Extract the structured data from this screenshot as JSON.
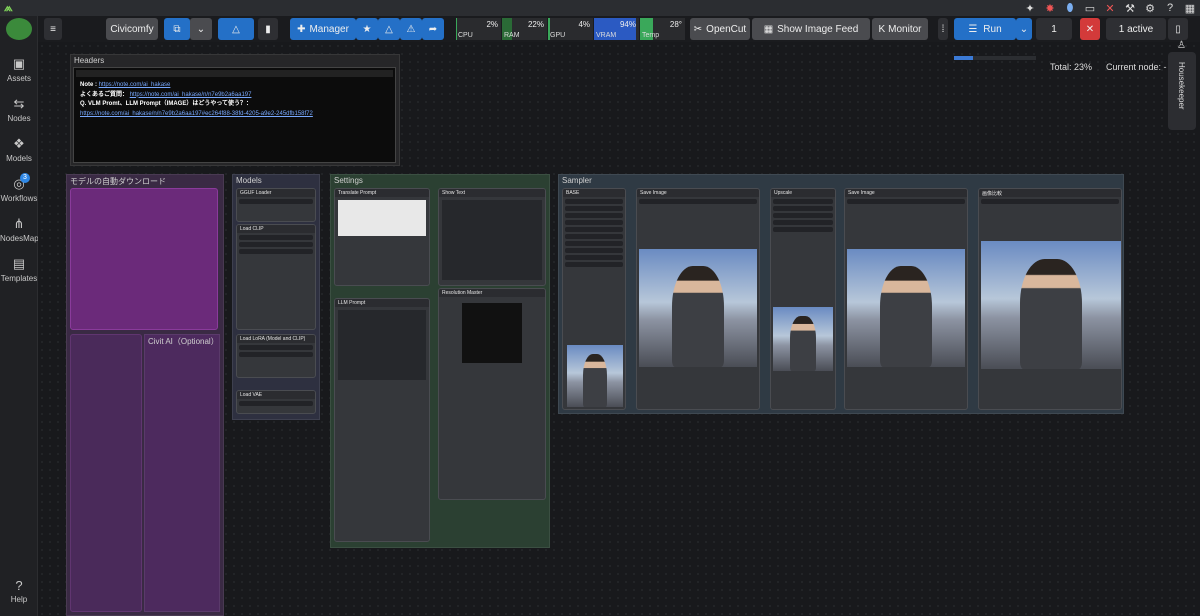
{
  "toolbar": {
    "app_name": "Civicomfy",
    "manager_label": "Manager",
    "opencut_label": "OpenCut",
    "show_feed_label": "Show Image Feed",
    "monitor_label": "Monitor",
    "run_label": "Run",
    "queue_count": "1",
    "active_label": "1 active"
  },
  "meters": [
    {
      "label": "CPU",
      "value": "2%",
      "color": "#3aa85a",
      "level": 0.02
    },
    {
      "label": "RAM",
      "value": "22%",
      "color": "#2a6a36",
      "level": 0.22
    },
    {
      "label": "GPU",
      "value": "4%",
      "color": "#3aa85a",
      "level": 0.04
    },
    {
      "label": "VRAM",
      "value": "94%",
      "color": "#2b5ac2",
      "level": 0.94
    },
    {
      "label": "Temp",
      "value": "28°",
      "color": "#3aa85a",
      "level": 0.28
    }
  ],
  "sidebar": {
    "items": [
      {
        "label": "Assets"
      },
      {
        "label": "Nodes"
      },
      {
        "label": "Models"
      },
      {
        "label": "Workflows",
        "badge": "3"
      },
      {
        "label": "NodesMap"
      },
      {
        "label": "Templates"
      },
      {
        "label": "Help"
      }
    ]
  },
  "status": {
    "total_label": "Total: 23%",
    "current_node_label": "Current node: -",
    "progress": 0.23
  },
  "housekeeper": "Housekeeper",
  "groups": {
    "headers": "Headers",
    "auto_download": "モデルの自動ダウンロード",
    "models": "Models",
    "settings": "Settings",
    "sampler": "Sampler",
    "civit_ai": "Civit AI（Optional）"
  },
  "notes": {
    "note_label": "Note :",
    "note_url": "https://note.com/ai_hakase",
    "faq_label": "よくあるご質問：",
    "faq_url": "https://note.com/ai_hakase/n/n7e9b2a6aa197",
    "q_label": "Q. VLM Promt、LLM Prompt（IMAGE）はどうやって使う？：",
    "q_url": "https://note.com/ai_hakase/n/n7e9b2a6aa197#ec264f88-38fd-4205-a9e2-245dfb158f72"
  },
  "nodes": {
    "gguf_loader": "GGUF Loader",
    "load_clip": "Load CLIP",
    "load_lora": "Load LoRA (Model and CLIP)",
    "load_vae": "Load VAE",
    "translate_prompt": "Translate Prompt",
    "show_text": "Show Text",
    "llm_prompt": "LLM Prompt",
    "resolution_master": "Resolution Master",
    "base": "BASE",
    "save_image_1": "Save Image",
    "upscale": "Upscale",
    "save_image_2": "Save Image",
    "image_compare": "画像比較"
  }
}
